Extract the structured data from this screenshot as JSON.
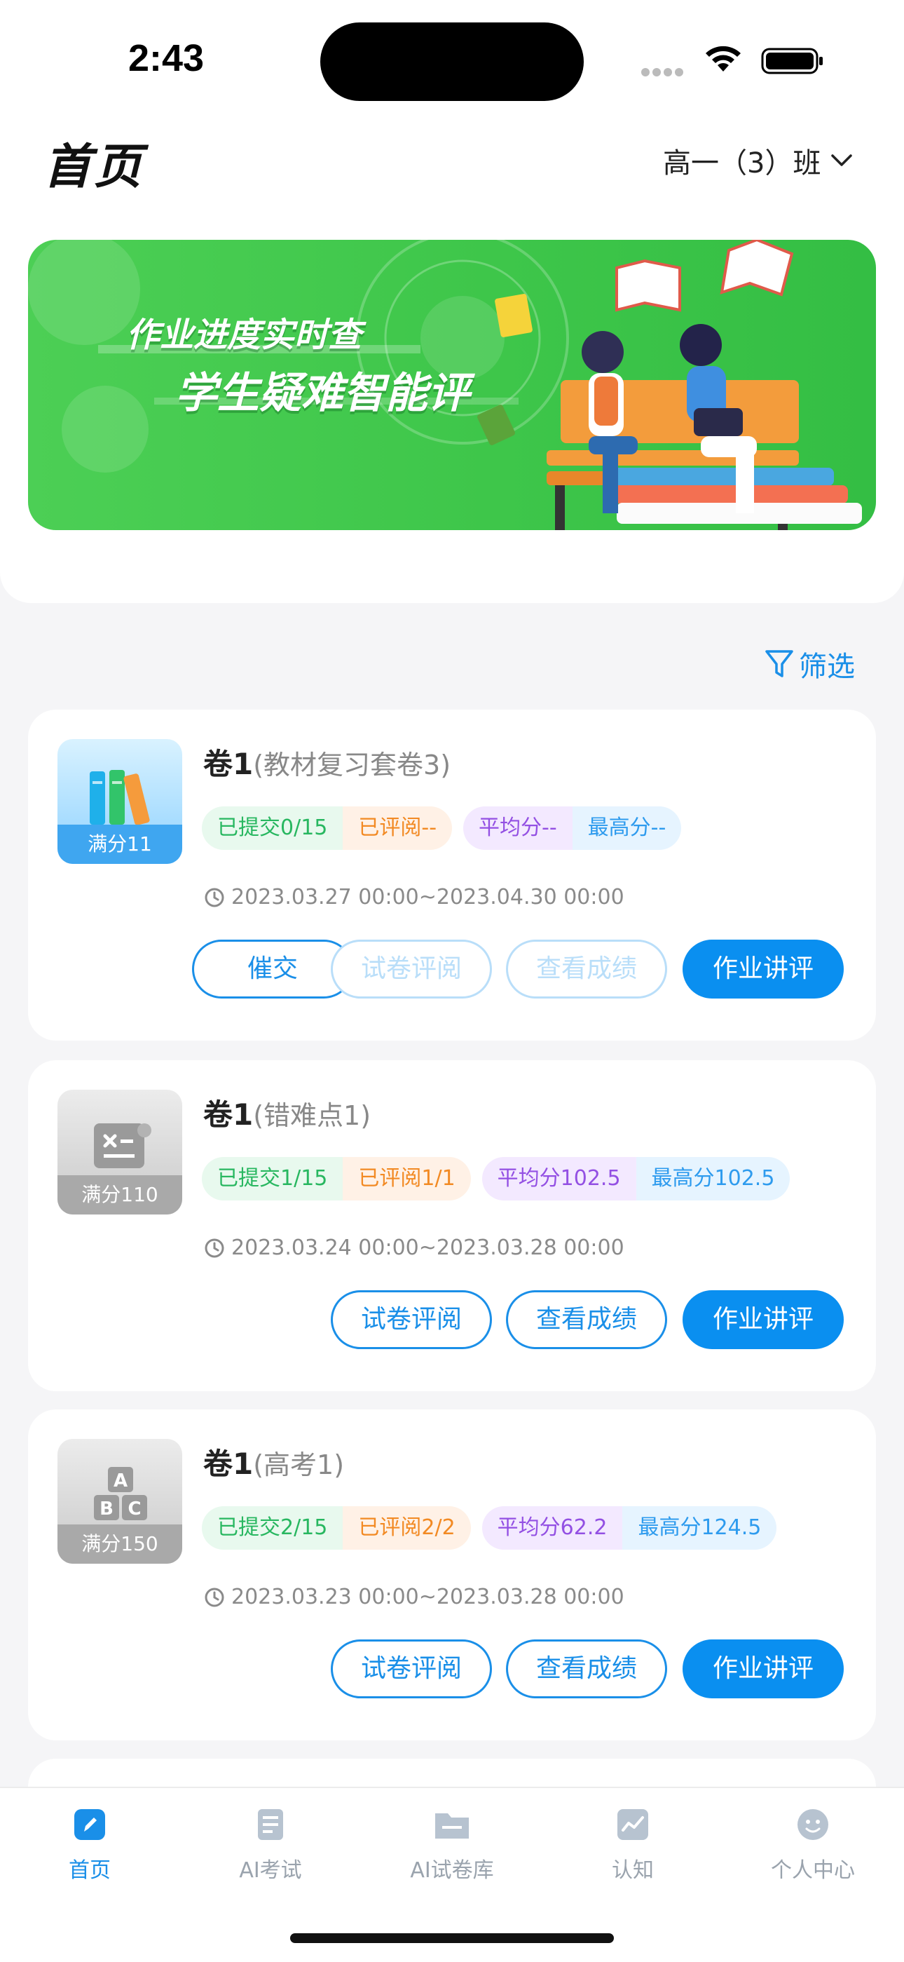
{
  "status_bar": {
    "time": "2:43"
  },
  "header": {
    "title": "首页",
    "class_selector": "高一（3）班"
  },
  "banner": {
    "line1": "作业进度实时查",
    "line2": "学生疑难智能评"
  },
  "filter_label": "筛选",
  "cards": [
    {
      "title": "卷1",
      "subtitle": "(教材复习套卷3)",
      "full_score": "满分11",
      "submitted": "已提交0/15",
      "reviewed": "已评阅--",
      "average": "平均分--",
      "highest": "最高分--",
      "date_range": "2023.03.27 00:00~2023.04.30 00:00",
      "buttons": [
        "催交",
        "试卷评阅",
        "查看成绩",
        "作业讲评"
      ]
    },
    {
      "title": "卷1",
      "subtitle": "(错难点1)",
      "full_score": "满分110",
      "submitted": "已提交1/15",
      "reviewed": "已评阅1/1",
      "average": "平均分102.5",
      "highest": "最高分102.5",
      "date_range": "2023.03.24 00:00~2023.03.28 00:00",
      "buttons": [
        "试卷评阅",
        "查看成绩",
        "作业讲评"
      ]
    },
    {
      "title": "卷1",
      "subtitle": "(高考1)",
      "full_score": "满分150",
      "submitted": "已提交2/15",
      "reviewed": "已评阅2/2",
      "average": "平均分62.2",
      "highest": "最高分124.5",
      "date_range": "2023.03.23 00:00~2023.03.28 00:00",
      "buttons": [
        "试卷评阅",
        "查看成绩",
        "作业讲评"
      ]
    }
  ],
  "tabbar": [
    {
      "label": "首页",
      "icon": "home-icon",
      "active": true
    },
    {
      "label": "AI考试",
      "icon": "exam-icon",
      "active": false
    },
    {
      "label": "AI试卷库",
      "icon": "folder-icon",
      "active": false
    },
    {
      "label": "认知",
      "icon": "chart-icon",
      "active": false
    },
    {
      "label": "个人中心",
      "icon": "profile-icon",
      "active": false
    }
  ],
  "colors": {
    "accent": "#0a8ff0",
    "banner_green": "#3ec64a"
  }
}
